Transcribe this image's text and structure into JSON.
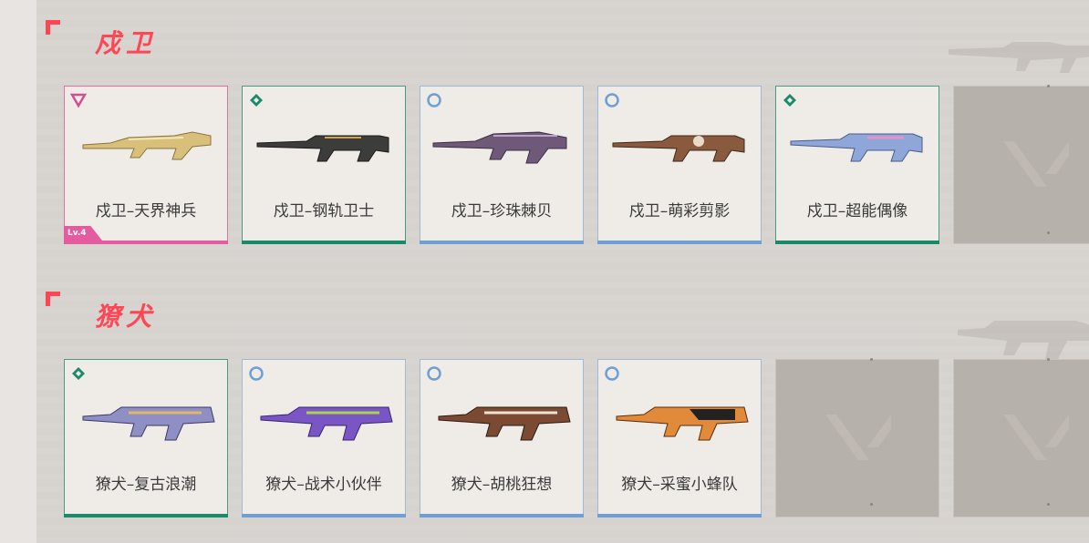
{
  "colors": {
    "accent": "#ff4655",
    "tier_pink": "#e45b9f",
    "tier_green": "#1b8a69",
    "tier_blue": "#6f9fd3"
  },
  "sections": [
    {
      "title": "戍卫",
      "cards": [
        {
          "name": "戍卫–天界神兵",
          "tier": "pink",
          "tier_icon": "triangle-icon",
          "level": "Lv.4"
        },
        {
          "name": "戍卫–钢轨卫士",
          "tier": "green",
          "tier_icon": "diamond-icon"
        },
        {
          "name": "戍卫–珍珠棘贝",
          "tier": "blue",
          "tier_icon": "circle-icon"
        },
        {
          "name": "戍卫–萌彩剪影",
          "tier": "blue",
          "tier_icon": "circle-icon"
        },
        {
          "name": "戍卫–超能偶像",
          "tier": "green",
          "tier_icon": "diamond-icon"
        }
      ]
    },
    {
      "title": "獠犬",
      "cards": [
        {
          "name": "獠犬–复古浪潮",
          "tier": "green",
          "tier_icon": "diamond-icon"
        },
        {
          "name": "獠犬–战术小伙伴",
          "tier": "blue",
          "tier_icon": "circle-icon"
        },
        {
          "name": "獠犬–胡桃狂想",
          "tier": "blue",
          "tier_icon": "circle-icon"
        },
        {
          "name": "獠犬–采蜜小蜂队",
          "tier": "blue",
          "tier_icon": "circle-icon"
        }
      ]
    }
  ]
}
